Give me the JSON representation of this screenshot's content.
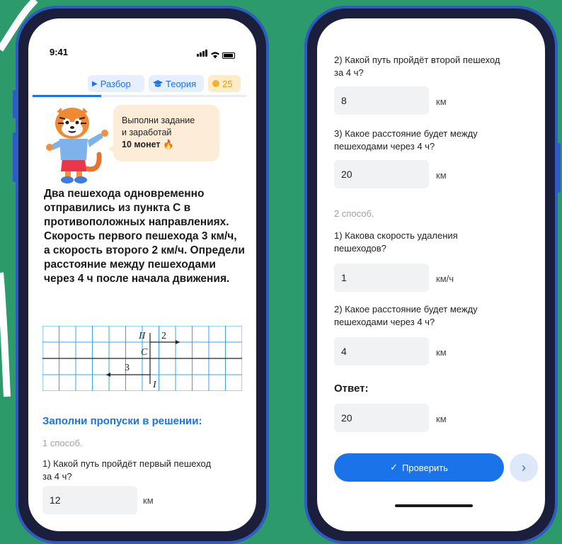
{
  "status": {
    "time": "9:41"
  },
  "topbar": {
    "review_label": "Разбор",
    "theory_label": "Теория",
    "coins": "25"
  },
  "progress": {
    "fraction": 0.32
  },
  "bubble": {
    "line1": "Выполни задание",
    "line2": "и заработай",
    "line3": "10 монет"
  },
  "problem": {
    "text": "Два пешехода одновременно отправились из пункта C в противоположных направлениях. Скорость первого пешехода 3 км/ч, а скорость второго 2 км/ч. Определи расстояние между пешеходами через 4 ч после начала движения."
  },
  "diagram": {
    "label_top": "II",
    "label_c": "C",
    "label_bottom": "I",
    "speed_top": "2",
    "speed_bottom": "3"
  },
  "solution": {
    "heading": "Заполни пропуски в решении:",
    "method1": "1 способ.",
    "q1": "1) Какой путь пройдёт первый пешеход за 4 ч?",
    "a1": "12",
    "q2": "2) Какой путь пройдёт второй пешеход за 4 ч?",
    "a2": "8",
    "q3": "3) Какое расстояние будет между пешеходами через 4 ч?",
    "a3": "20",
    "method2": "2 способ.",
    "q4": "1) Какова скорость удаления пешеходов?",
    "a4": "1",
    "q5": "2) Какое расстояние будет между пешеходами через 4 ч?",
    "a5": "4",
    "answer_label": "Ответ:",
    "answer_value": "20"
  },
  "units": {
    "km": "км",
    "kmh": "км/ч"
  },
  "actions": {
    "check_label": "Проверить"
  }
}
